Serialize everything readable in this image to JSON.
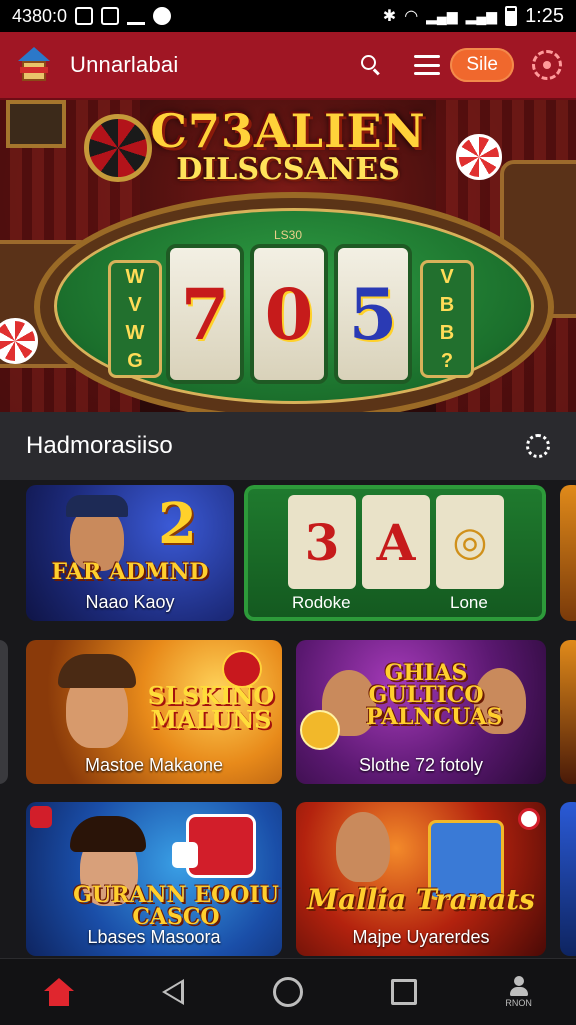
{
  "status_bar": {
    "left_text": "4380:0",
    "time": "1:25"
  },
  "app_bar": {
    "title": "Unnarlabai",
    "pill_label": "Sile"
  },
  "hero": {
    "title_line1": "C73ALIEN",
    "title_line2": "DILSCSANES",
    "table_label": "LS30",
    "reel_symbols": [
      "7",
      "0",
      "5"
    ],
    "side_left": [
      "W",
      "V",
      "W",
      "G"
    ],
    "side_right": [
      "V",
      "B",
      "B",
      "?"
    ]
  },
  "section": {
    "title": "Hadmorasiiso"
  },
  "cards": [
    {
      "headline": "FAR ADMND",
      "caption": "Naao Kaoy"
    },
    {
      "reel_symbols": [
        "3",
        "A",
        "◎"
      ],
      "caption_left": "Rodoke",
      "caption_right": "Lone"
    },
    {
      "headline": "SLSKINO MALUNS",
      "caption": "Mastoe Makaone"
    },
    {
      "headline": "GHIAS GULTICO PALNCUAS",
      "caption": "Slothe 72 fotoly"
    },
    {
      "headline": "GURANN EOOIU CASCO",
      "caption": "Lbases Masoora"
    },
    {
      "headline": "Mallia Tranats",
      "caption": "Majpe Uyarerdes"
    }
  ],
  "bottom_nav": {
    "profile_label": "RNON"
  },
  "colors": {
    "app_bar": "#a01624",
    "accent_pill": "#f0682d",
    "home_active": "#e0262e"
  }
}
